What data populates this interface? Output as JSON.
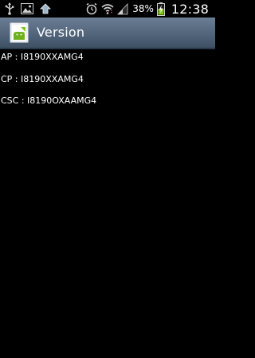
{
  "status_bar": {
    "icons_left": [
      "usb-icon",
      "gallery-icon",
      "upload-icon"
    ],
    "icons_right": [
      "alarm-icon",
      "wifi-icon",
      "signal-icon",
      "battery-charging-icon"
    ],
    "battery_percent": "38%",
    "time": "12:38"
  },
  "action_bar": {
    "title": "Version",
    "icon": "app-icon",
    "color": "#566a80"
  },
  "content": {
    "lines": [
      "AP : I8190XXAMG4",
      "CP : I8190XXAMG4",
      "CSC : I8190OXAAMG4"
    ]
  }
}
